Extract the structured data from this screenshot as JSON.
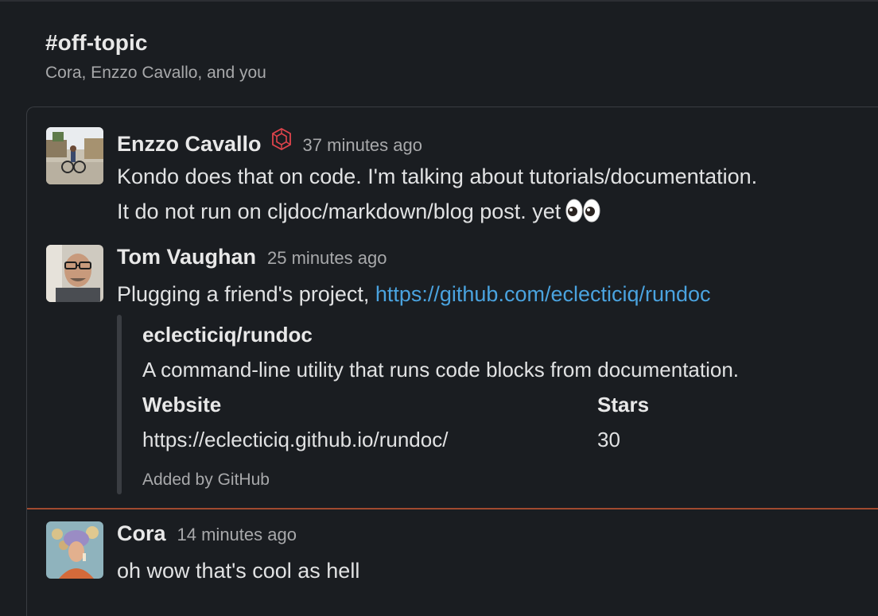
{
  "channel": {
    "title": "#off-topic",
    "members": "Cora, Enzzo Cavallo, and you"
  },
  "messages": [
    {
      "author": "Enzzo Cavallo",
      "time": "37 minutes ago",
      "lines": [
        "Kondo does that on code. I'm talking about tutorials/documentation.",
        "It do not run on cljdoc/markdown/blog post. yet"
      ],
      "avatar_icon": "cyclist-photo-avatar",
      "badge_icon": "hexagon-cube-badge-icon",
      "badge_color": "#e0444c",
      "emoji": "eyes-emoji"
    },
    {
      "author": "Tom Vaughan",
      "time": "25 minutes ago",
      "text_prefix": "Plugging a friend's project, ",
      "link": "https://github.com/eclecticiq/rundoc",
      "avatar_icon": "man-with-glasses-avatar",
      "unfurl": {
        "title": "eclecticiq/rundoc",
        "description": "A command-line utility that runs code blocks from documentation.",
        "fields": [
          {
            "label": "Website",
            "value": "https://eclecticiq.github.io/rundoc/"
          },
          {
            "label": "Stars",
            "value": "30"
          }
        ],
        "footer": "Added by GitHub"
      }
    },
    {
      "author": "Cora",
      "time": "14 minutes ago",
      "text": "oh wow that's cool as hell",
      "avatar_icon": "illustrated-woman-avatar"
    }
  ],
  "colors": {
    "background": "#1a1d21",
    "link": "#4aa3df",
    "new_divider": "#a14a2f"
  }
}
